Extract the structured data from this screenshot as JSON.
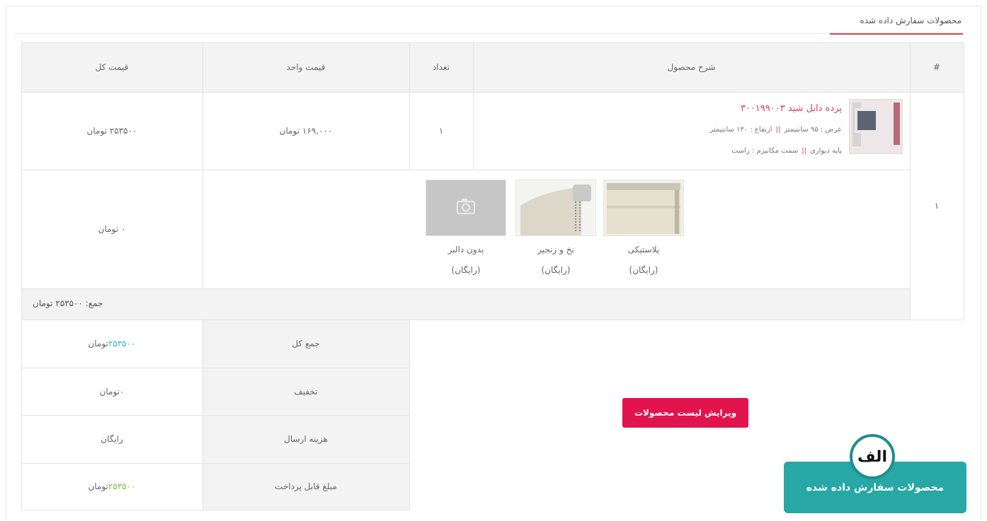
{
  "header": {
    "title": "محصولات سفارش داده شده"
  },
  "table": {
    "columns": [
      "#",
      "شرح محصول",
      "تعداد",
      "قیمت واحد",
      "قیمت کل"
    ],
    "row_number": "۱",
    "product": {
      "name": "پرده دابل شید ۳۰۰۱۹۹۰۰۳",
      "attr_line1_a": "عرض : ۹۵ سانتیمتر",
      "attr_line1_b": "ارتفاع : ۱۳۰ سانتیمتر",
      "attr_line2_a": "پایه دیواری",
      "attr_line2_b": "سمت مکانیزم : راست",
      "separator": "||"
    },
    "quantity": "۱",
    "unit_price": "۱۶۹,۰۰۰ تومان",
    "total_price": "۲۵۳۵۰۰ تومان",
    "options": [
      {
        "label": "پلاستیکی",
        "price": "(رایگان)"
      },
      {
        "label": "نخ و زنجیر",
        "price": "(رایگان)"
      },
      {
        "label": "بدون دالبر",
        "price": "(رایگان)"
      }
    ],
    "options_total": "۰ تومان",
    "subtotal": "جمع: ۲۵۳۵۰۰ تومان"
  },
  "summary": {
    "rows": [
      {
        "label": "جمع کل",
        "value_num": "۲۵۳۵۰۰",
        "value_unit": " تومان"
      },
      {
        "label": "تخفیف",
        "value_num": "۰",
        "value_unit": " تومان"
      },
      {
        "label": "هزینه ارسال",
        "value_num": "رایگان",
        "value_unit": ""
      },
      {
        "label": "مبلغ قابل پرداخت",
        "value_num": "۲۵۳۵۰۰",
        "value_unit": " تومان"
      }
    ]
  },
  "actions": {
    "edit_label": "ویرایش لیست محصولات"
  },
  "badge": {
    "letter": "الف",
    "text": "محصولات سفارش داده شده"
  },
  "colors": {
    "accent": "#d63f66",
    "button": "#e2144d",
    "badge": "#27a7a6",
    "blue_value": "#34b7cc",
    "green_value": "#71c63d"
  },
  "icons": {
    "no_image": "camera-icon"
  }
}
